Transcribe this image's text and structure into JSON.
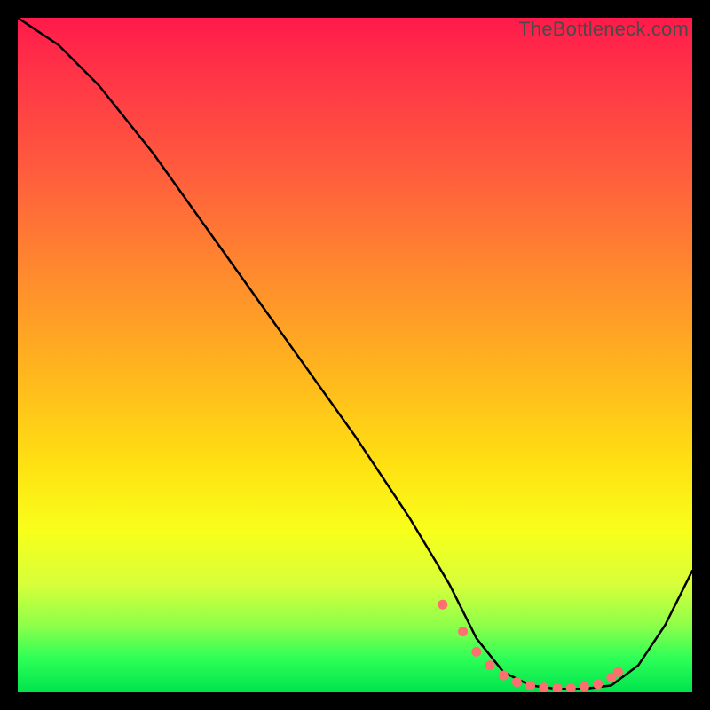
{
  "watermark": "TheBottleneck.com",
  "colors": {
    "gradient_top": "#ff1a4b",
    "gradient_bottom": "#00e34d",
    "line": "#000000",
    "marker": "#ff6f6f",
    "frame": "#000000"
  },
  "chart_data": {
    "type": "line",
    "title": "",
    "xlabel": "",
    "ylabel": "",
    "xlim": [
      0,
      100
    ],
    "ylim": [
      0,
      100
    ],
    "note": "Axes are unlabeled; x and y are normalized 0–100 from the visible plot area. Curve depicts a bottleneck-style curve: steep descent from top-left, flat minimum near x≈70–85, rising on the right. Markers cluster along the flat minimum.",
    "series": [
      {
        "name": "bottleneck-curve",
        "x": [
          0,
          6,
          12,
          20,
          30,
          40,
          50,
          58,
          64,
          68,
          72,
          76,
          80,
          84,
          88,
          92,
          96,
          100
        ],
        "y": [
          100,
          96,
          90,
          80,
          66,
          52,
          38,
          26,
          16,
          8,
          3,
          1,
          0.5,
          0.5,
          1,
          4,
          10,
          18
        ]
      }
    ],
    "markers": {
      "name": "highlighted-points",
      "x": [
        63,
        66,
        68,
        70,
        72,
        74,
        76,
        78,
        80,
        82,
        84,
        86,
        88,
        89
      ],
      "y": [
        13,
        9,
        6,
        4,
        2.5,
        1.5,
        1,
        0.7,
        0.6,
        0.6,
        0.8,
        1.2,
        2.2,
        3
      ]
    }
  }
}
